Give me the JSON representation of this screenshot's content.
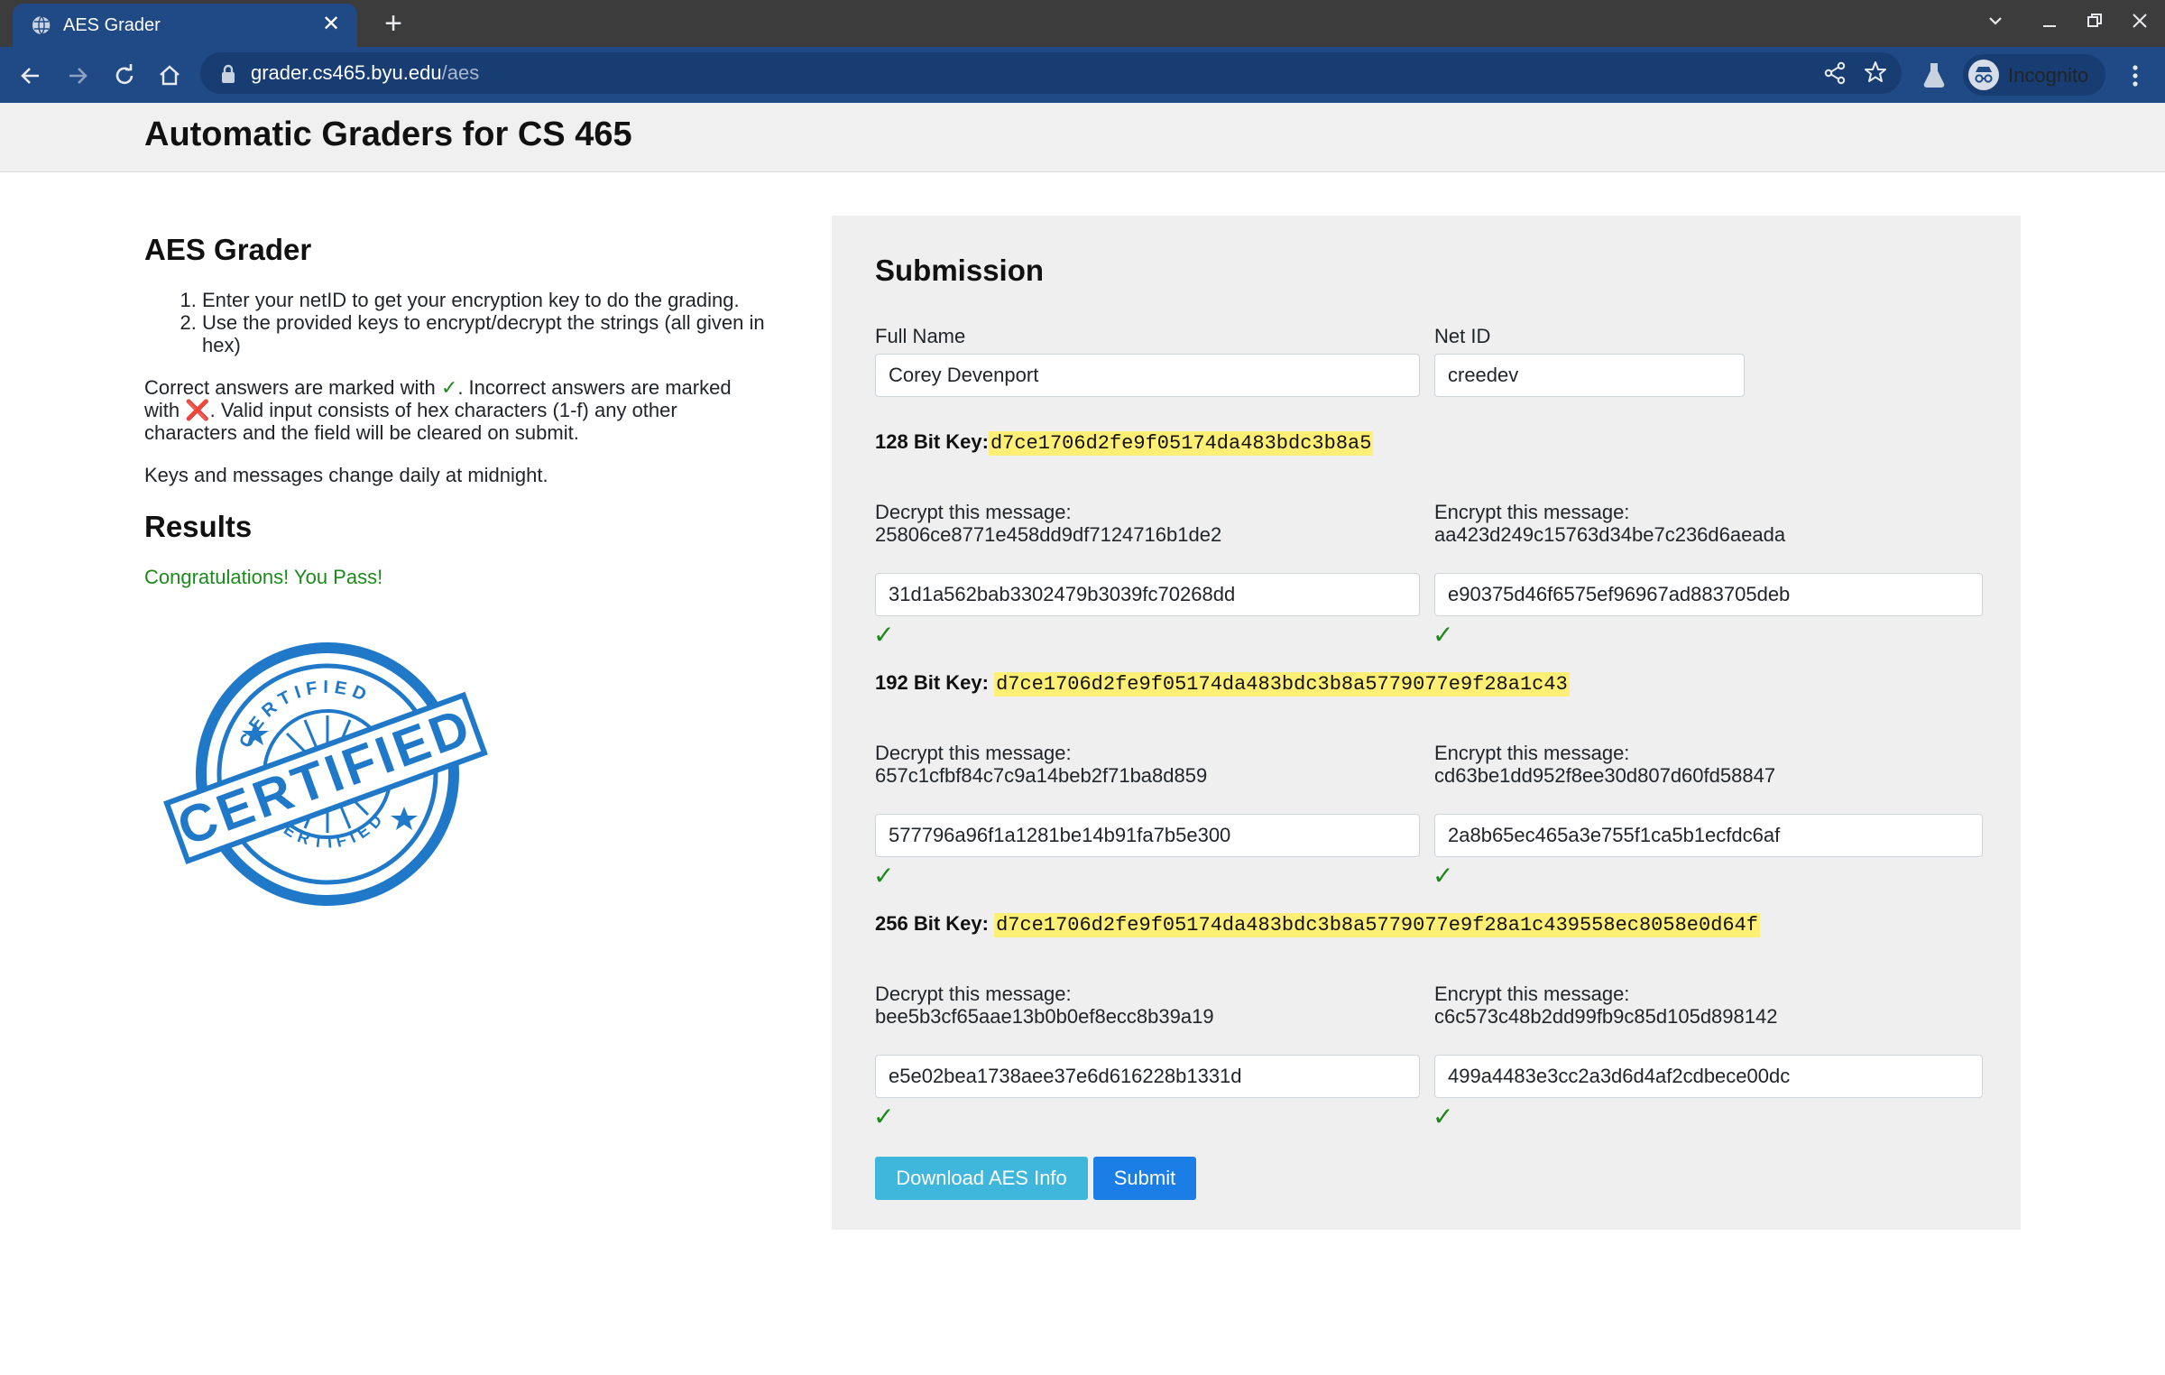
{
  "browser": {
    "tab_title": "AES Grader",
    "url_host": "grader.cs465.byu.edu",
    "url_path": "/aes",
    "profile_label": "Incognito"
  },
  "header": {
    "title": "Automatic Graders for CS 465"
  },
  "left": {
    "heading": "AES Grader",
    "instructions": [
      "Enter your netID to get your encryption key to do the grading.",
      "Use the provided keys to encrypt/decrypt the strings (all given in hex)"
    ],
    "correct_prefix": "Correct answers are marked with ",
    "correct_mark": "✓",
    "incorrect_mid": ". Incorrect answers are marked with ",
    "incorrect_mark": "❌",
    "valid_suffix": ". Valid input consists of hex characters (1-f) any other characters and the field will be cleared on submit.",
    "keys_note": "Keys and messages change daily at midnight.",
    "results_heading": "Results",
    "result_text": "Congratulations! You Pass!",
    "stamp_word": "CERTIFIED",
    "stamp_small_top": "CERTIFIED",
    "stamp_small_bottom": "CERTIFIED"
  },
  "submission": {
    "heading": "Submission",
    "full_name_label": "Full Name",
    "full_name_value": "Corey Devenport",
    "netid_label": "Net ID",
    "netid_value": "creedev",
    "sections": [
      {
        "key_label": "128 Bit Key:",
        "key_value": "d7ce1706d2fe9f05174da483bdc3b8a5",
        "decrypt_label": "Decrypt this message:",
        "decrypt_message": "25806ce8771e458dd9df7124716b1de2",
        "decrypt_answer": "31d1a562bab3302479b3039fc70268dd",
        "encrypt_label": "Encrypt this message:",
        "encrypt_message": "aa423d249c15763d34be7c236d6aeada",
        "encrypt_answer": "e90375d46f6575ef96967ad883705deb",
        "mark": "✓"
      },
      {
        "key_label": "192 Bit Key: ",
        "key_value": "d7ce1706d2fe9f05174da483bdc3b8a5779077e9f28a1c43",
        "decrypt_label": "Decrypt this message:",
        "decrypt_message": "657c1cfbf84c7c9a14beb2f71ba8d859",
        "decrypt_answer": "577796a96f1a1281be14b91fa7b5e300",
        "encrypt_label": "Encrypt this message:",
        "encrypt_message": "cd63be1dd952f8ee30d807d60fd58847",
        "encrypt_answer": "2a8b65ec465a3e755f1ca5b1ecfdc6af",
        "mark": "✓"
      },
      {
        "key_label": "256 Bit Key: ",
        "key_value": "d7ce1706d2fe9f05174da483bdc3b8a5779077e9f28a1c439558ec8058e0d64f",
        "decrypt_label": "Decrypt this message:",
        "decrypt_message": "bee5b3cf65aae13b0b0ef8ecc8b39a19",
        "decrypt_answer": "e5e02bea1738aee37e6d616228b1331d",
        "encrypt_label": "Encrypt this message:",
        "encrypt_message": "c6c573c48b2dd99fb9c85d105d898142",
        "encrypt_answer": "499a4483e3cc2a3d6d4af2cdbece00dc",
        "mark": "✓"
      }
    ],
    "download_button": "Download AES Info",
    "submit_button": "Submit"
  },
  "colors": {
    "chrome_dark": "#3c3c3c",
    "chrome_blue": "#1f4a86",
    "key_highlight": "#ffef74",
    "success_green": "#1b8a1b",
    "btn_info": "#3fb6dc",
    "btn_primary": "#1a7ee6",
    "stamp_blue": "#1f78c8"
  },
  "icons": [
    "globe-icon",
    "close-icon",
    "plus-icon",
    "chevron-down-icon",
    "minimize-icon",
    "restore-icon",
    "back-icon",
    "forward-icon",
    "reload-icon",
    "home-icon",
    "lock-icon",
    "share-icon",
    "star-icon",
    "flask-icon",
    "incognito-icon",
    "kebab-menu-icon"
  ]
}
